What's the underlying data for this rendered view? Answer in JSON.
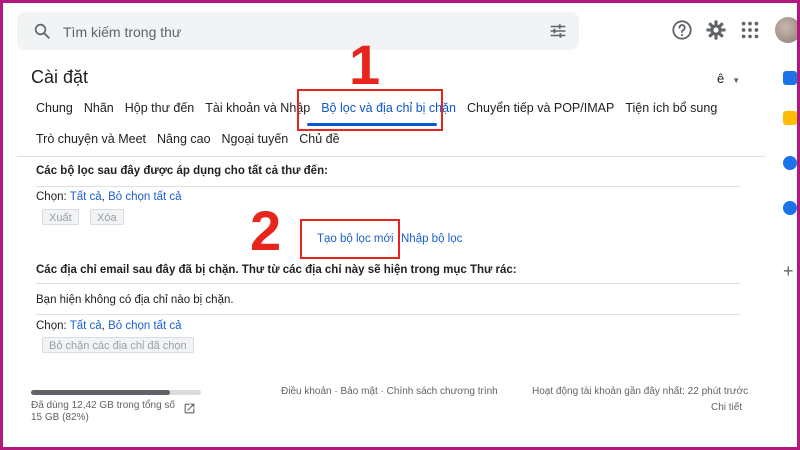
{
  "search": {
    "placeholder": "Tìm kiếm trong thư"
  },
  "header": {
    "title": "Cài đặt",
    "language": "ê"
  },
  "tabs_row1": [
    "Chung",
    "Nhãn",
    "Hộp thư đến",
    "Tài khoản và Nhập",
    "Bộ lọc và địa chỉ bị chặn",
    "Chuyển tiếp và POP/IMAP",
    "Tiện ích bổ sung"
  ],
  "tabs_row2": [
    "Trò chuyện và Meet",
    "Nâng cao",
    "Ngoại tuyến",
    "Chủ đề"
  ],
  "active_tab": "Bộ lọc và địa chỉ bị chặn",
  "filters": {
    "heading": "Các bộ lọc sau đây được áp dụng cho tất cả thư đến:",
    "select_label": "Chọn:",
    "select_all": "Tất cả",
    "separator": ",",
    "deselect_all": "Bỏ chọn tất cả",
    "export_button": "Xuất",
    "delete_button": "Xóa",
    "create_link": "Tạo bộ lọc mới",
    "import_link": "Nhập bộ lọc"
  },
  "blocked": {
    "heading": "Các địa chỉ email sau đây đã bị chặn. Thư từ các địa chỉ này sẽ hiện trong mục Thư rác:",
    "empty_message": "Bạn hiện không có địa chỉ nào bị chặn.",
    "select_label": "Chọn:",
    "select_all": "Tất cả",
    "separator": ",",
    "deselect_all": "Bỏ chọn tất cả",
    "unblock_button": "Bỏ chặn các địa chỉ đã chọn"
  },
  "footer": {
    "storage_line1": "Đã dùng 12,42 GB trong tổng số",
    "storage_line2": "15 GB (82%)",
    "storage_percent": 82,
    "terms": "Điều khoản",
    "dot1": "·",
    "privacy": "Bảo mật",
    "dot2": "·",
    "program_policy": "Chính sách chương trình",
    "last_activity": "Hoạt động tài khoản gần đây nhất: 22 phút trước",
    "details": "Chi tiết"
  },
  "annotations": {
    "step1": "1",
    "step2": "2"
  },
  "colors": {
    "accent": "#0b57d0",
    "annotation": "#e8251c",
    "frame": "#b0187c",
    "link": "#1a5fd0"
  },
  "icons": [
    "search-icon",
    "tune-icon",
    "help-icon",
    "gear-icon",
    "apps-grid-icon",
    "open-external-icon",
    "calendar-icon",
    "keep-icon",
    "tasks-icon",
    "contacts-icon",
    "add-icon"
  ]
}
